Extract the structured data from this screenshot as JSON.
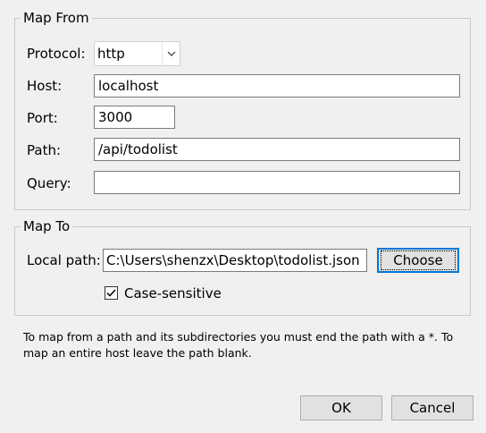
{
  "map_from": {
    "title": "Map From",
    "protocol_label": "Protocol:",
    "protocol_value": "http",
    "host_label": "Host:",
    "host_value": "localhost",
    "port_label": "Port:",
    "port_value": "3000",
    "path_label": "Path:",
    "path_value": "/api/todolist",
    "query_label": "Query:",
    "query_value": ""
  },
  "map_to": {
    "title": "Map To",
    "local_path_label": "Local path:",
    "local_path_value": "C:\\Users\\shenzx\\Desktop\\todolist.json",
    "choose_label": "Choose",
    "case_sensitive_label": "Case-sensitive",
    "case_sensitive_checked": true
  },
  "note": "To map from a path and its subdirectories you must end the path with a *. To map an entire host leave the path blank.",
  "buttons": {
    "ok": "OK",
    "cancel": "Cancel"
  },
  "icons": {
    "dropdown": "chevron-down-icon",
    "check": "checkmark-icon"
  }
}
